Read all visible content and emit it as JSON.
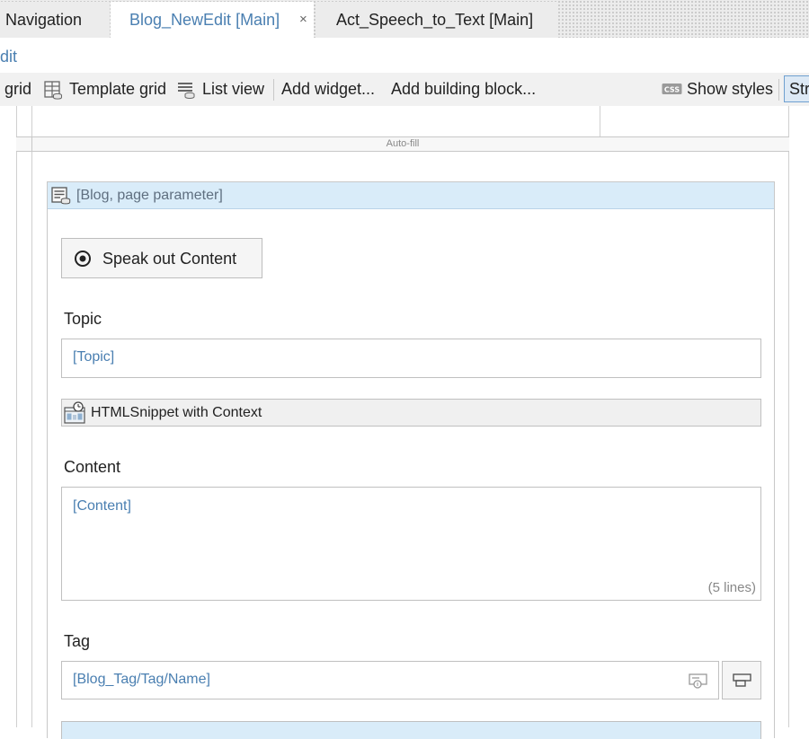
{
  "tabs": [
    {
      "label": "Navigation"
    },
    {
      "label": "Blog_NewEdit [Main]",
      "close": "×"
    },
    {
      "label": "Act_Speech_to_Text [Main]"
    }
  ],
  "crumb": "dit",
  "toolbar": {
    "grid_label": "grid",
    "template_grid_label": "Template grid",
    "list_view_label": "List view",
    "add_widget_label": "Add widget...",
    "add_building_block_label": "Add building block...",
    "show_styles_label": "Show styles",
    "structure_label": "Str",
    "css_badge": "CSS"
  },
  "canvas": {
    "autofill_label": "Auto-fill"
  },
  "dataview": {
    "title": "[Blog, page parameter]",
    "speak_button_label": "Speak out Content",
    "topic_label": "Topic",
    "topic_placeholder": "[Topic]",
    "snippet_label": "HTMLSnippet with Context",
    "content_label": "Content",
    "content_placeholder": "[Content]",
    "content_lines_hint": "(5 lines)",
    "tag_label": "Tag",
    "tag_placeholder": "[Blog_Tag/Tag/Name]"
  },
  "colors": {
    "accent_text": "#4a7fb1",
    "dataview_header_bg": "#d9ecf9",
    "toolbar_bg": "#f1f1f1"
  },
  "icons": [
    "grid-icon",
    "template-grid-icon",
    "list-view-icon",
    "css-icon",
    "dataview-icon",
    "radio-dot-icon",
    "htmlsnippet-icon",
    "reference-selector-icon",
    "select-page-icon"
  ]
}
